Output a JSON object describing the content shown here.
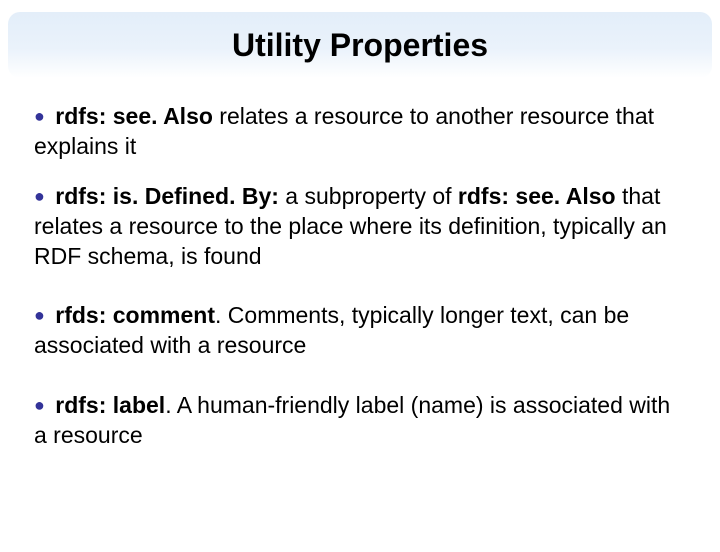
{
  "title": "Utility Properties",
  "items": [
    {
      "term": "rdfs: see. Also",
      "rest": " relates a resource to another resource that explains it",
      "term2": "",
      "rest2": ""
    },
    {
      "term": "rdfs: is. Defined. By:",
      "rest": " a subproperty of ",
      "term2": "rdfs: see. Also",
      "rest2": " that relates a resource to the place where its definition, typically an RDF schema, is found"
    },
    {
      "term": "rfds: comment",
      "rest": ". Comments, typically longer text, can be associated with a resource",
      "term2": "",
      "rest2": ""
    },
    {
      "term": "rdfs: label",
      "rest": ". A human-friendly label (name) is associated with a resource",
      "term2": "",
      "rest2": ""
    }
  ]
}
